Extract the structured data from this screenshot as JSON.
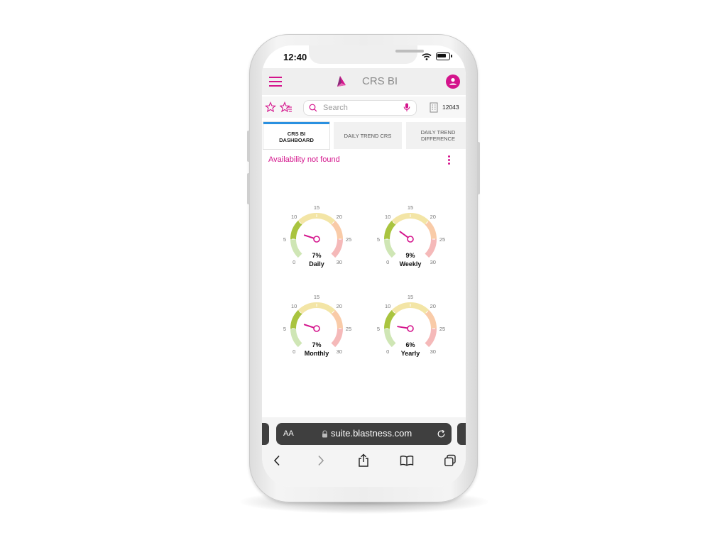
{
  "status_bar": {
    "time": "12:40"
  },
  "app": {
    "title": "CRS BI"
  },
  "toolbar": {
    "search_placeholder": "Search",
    "hotel_id": "12043"
  },
  "tabs": [
    {
      "label_line1": "CRS BI",
      "label_line2": "DASHBOARD",
      "active": true
    },
    {
      "label_line1": "DAILY TREND CRS",
      "label_line2": "",
      "active": false
    },
    {
      "label_line1": "DAILY TREND",
      "label_line2": "DIFFERENCE",
      "active": false
    }
  ],
  "availability_message": "Availability not found",
  "gauges": {
    "scale_labels": [
      "0",
      "5",
      "10",
      "15",
      "20",
      "25",
      "30"
    ],
    "items": [
      {
        "value_text": "7%",
        "value": 7,
        "label": "Daily"
      },
      {
        "value_text": "9%",
        "value": 9,
        "label": "Weekly"
      },
      {
        "value_text": "7%",
        "value": 7,
        "label": "Monthly"
      },
      {
        "value_text": "6%",
        "value": 6,
        "label": "Yearly"
      }
    ]
  },
  "browser": {
    "text_size_label": "AA",
    "url": "suite.blastness.com"
  },
  "colors": {
    "accent": "#d4148c",
    "tab_active_border": "#2a90e0",
    "gauge_band_low": "#cfe6b5",
    "gauge_band_mid_low": "#a9c43f",
    "gauge_band_mid": "#f3e5a6",
    "gauge_band_high": "#f9cba8",
    "gauge_band_top": "#f5b9b9"
  }
}
